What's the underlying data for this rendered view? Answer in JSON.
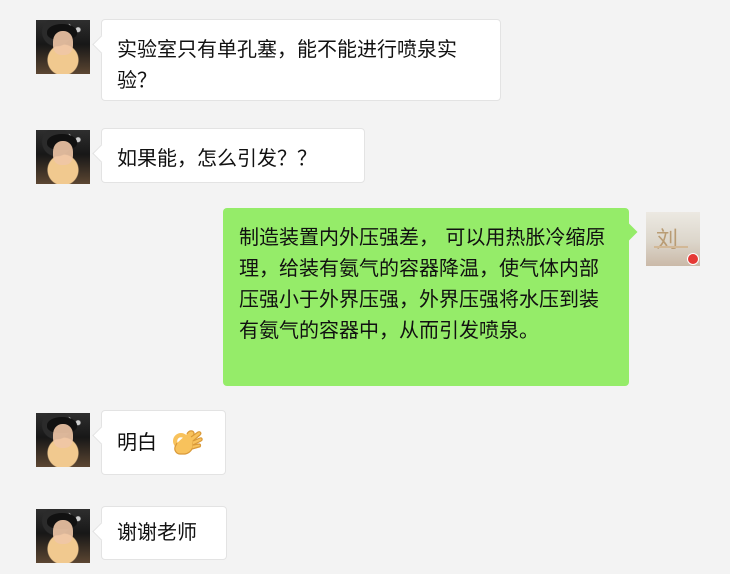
{
  "chat": {
    "messages": [
      {
        "id": "m1",
        "sender": "other",
        "text": "实验室只有单孔塞，能不能进行喷泉实验？"
      },
      {
        "id": "m2",
        "sender": "other",
        "text": "如果能，怎么引发？？"
      },
      {
        "id": "m3",
        "sender": "self",
        "text": "制造装置内外压强差， 可以用热胀冷缩原理，给装有氨气的容器降温，使气体内部压强小于外界压强，外界压强将水压到装有氨气的容器中，从而引发喷泉。"
      },
      {
        "id": "m4",
        "sender": "other",
        "text": "明白",
        "emoji": "ok-hand-icon"
      },
      {
        "id": "m5",
        "sender": "other",
        "text": "谢谢老师"
      }
    ]
  },
  "avatars": {
    "other_name": "student-avatar",
    "self_name": "teacher-avatar"
  },
  "colors": {
    "background": "#f3f3f3",
    "incoming_bubble": "#ffffff",
    "outgoing_bubble": "#95ec69",
    "text": "#111111"
  }
}
